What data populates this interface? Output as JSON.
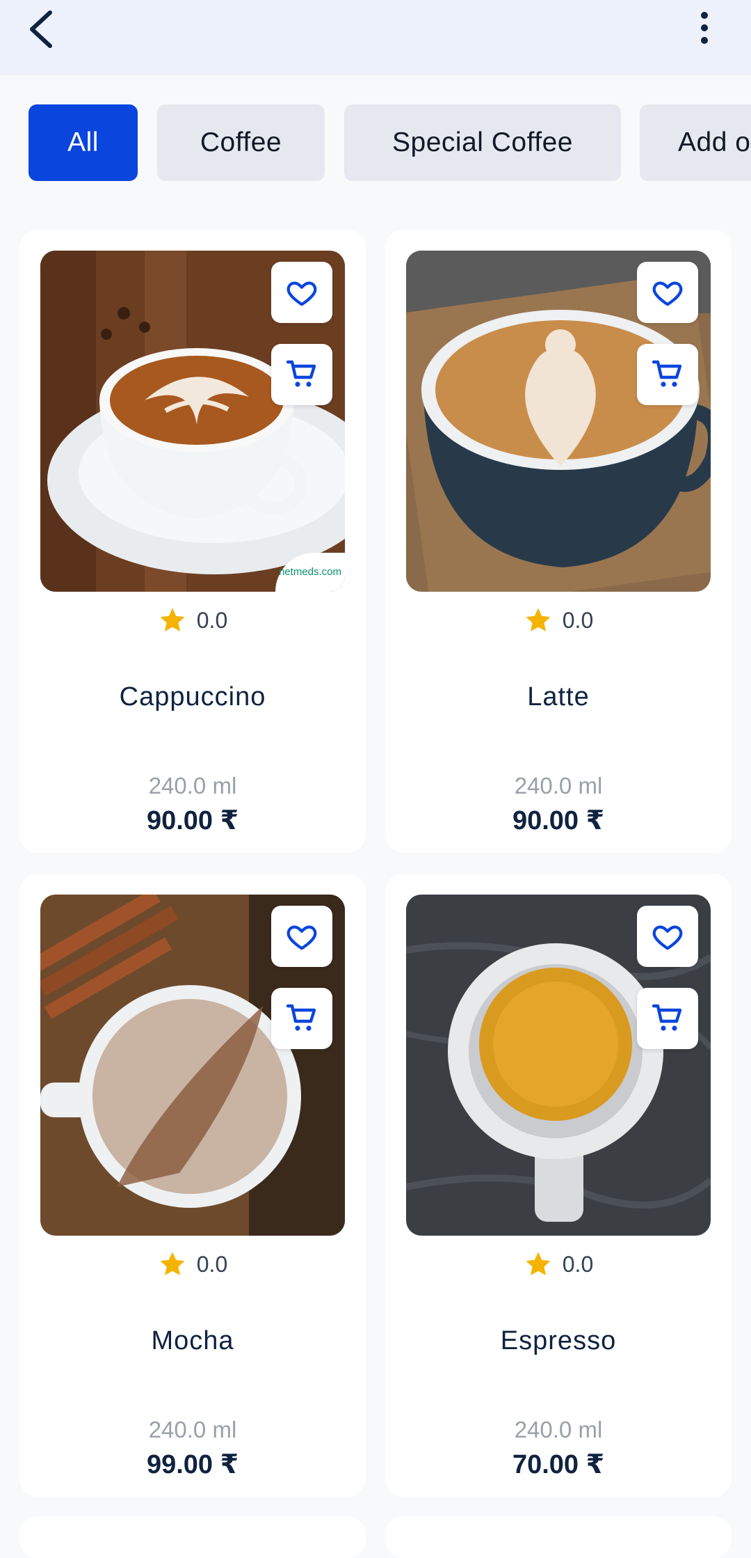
{
  "topbar": {
    "back_icon": "chevron-left-icon",
    "more_icon": "more-vertical-icon"
  },
  "categories": [
    {
      "label": "All",
      "active": true
    },
    {
      "label": "Coffee",
      "active": false
    },
    {
      "label": "Special Coffee",
      "active": false
    },
    {
      "label": "Add o",
      "active": false
    }
  ],
  "products": [
    {
      "name": "Cappuccino",
      "rating": "0.0",
      "size": "240.0 ml",
      "price": "90.00 ₹",
      "watermark": "netmeds.com"
    },
    {
      "name": "Latte",
      "rating": "0.0",
      "size": "240.0 ml",
      "price": "90.00 ₹"
    },
    {
      "name": "Mocha",
      "rating": "0.0",
      "size": "240.0 ml",
      "price": "99.00 ₹"
    },
    {
      "name": "Espresso",
      "rating": "0.0",
      "size": "240.0 ml",
      "price": "70.00 ₹"
    }
  ],
  "colors": {
    "accent": "#0a45dd",
    "title": "#0f2240",
    "star": "#f5b301",
    "icon": "#0a45dd"
  }
}
